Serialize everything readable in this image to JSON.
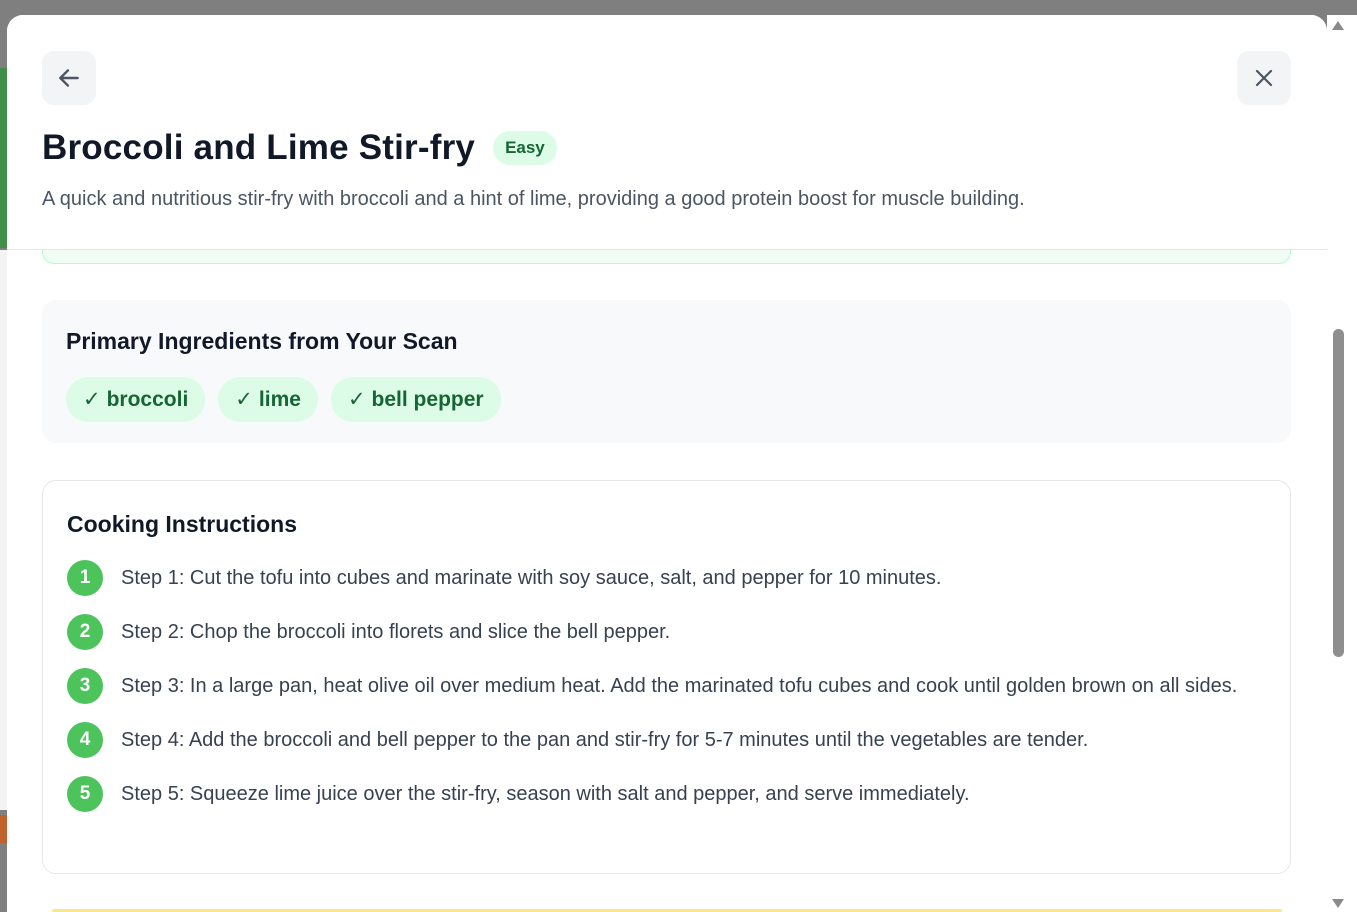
{
  "recipe": {
    "title": "Broccoli and Lime Stir-fry",
    "difficulty": "Easy",
    "description": "A quick and nutritious stir-fry with broccoli and a hint of lime, providing a good protein boost for muscle building."
  },
  "ingredients": {
    "heading": "Primary Ingredients from Your Scan",
    "check_glyph": "✓",
    "items": [
      "broccoli",
      "lime",
      "bell pepper"
    ]
  },
  "instructions": {
    "heading": "Cooking Instructions",
    "steps": [
      {
        "num": "1",
        "text": "Step 1: Cut the tofu into cubes and marinate with soy sauce, salt, and pepper for 10 minutes."
      },
      {
        "num": "2",
        "text": "Step 2: Chop the broccoli into florets and slice the bell pepper."
      },
      {
        "num": "3",
        "text": "Step 3: In a large pan, heat olive oil over medium heat. Add the marinated tofu cubes and cook until golden brown on all sides."
      },
      {
        "num": "4",
        "text": "Step 4: Add the broccoli and bell pepper to the pan and stir-fry for 5-7 minutes until the vegetables are tender."
      },
      {
        "num": "5",
        "text": "Step 5: Squeeze lime juice over the stir-fry, season with salt and pepper, and serve immediately."
      }
    ]
  },
  "icons": {
    "back": "arrow-left-icon",
    "close": "close-icon"
  },
  "colors": {
    "accent": "#4cc35b",
    "badge_bg": "#dcfce7",
    "badge_text": "#166534"
  }
}
